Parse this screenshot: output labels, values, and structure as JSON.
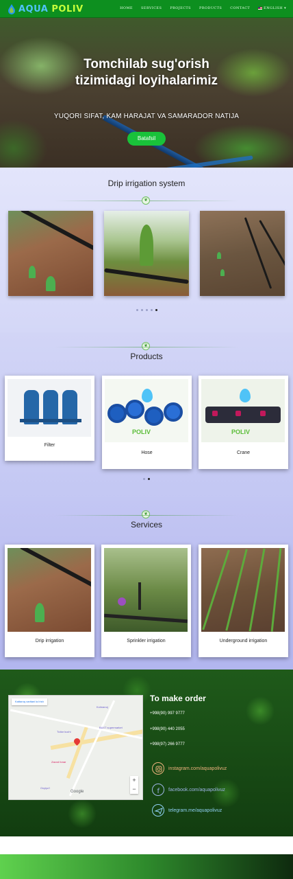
{
  "header": {
    "logo_part1": "AQUA",
    "logo_part2": "POLIV",
    "nav": [
      {
        "label": "HOME"
      },
      {
        "label": "SERVICES"
      },
      {
        "label": "PROJECTS"
      },
      {
        "label": "PRODUCTS"
      },
      {
        "label": "CONTACT"
      }
    ],
    "language": "ENGLISH",
    "language_caret": "▾"
  },
  "hero": {
    "title_line1": "Tomchilab sug'orish",
    "title_line2": "tizimidagi loyihalarimiz",
    "subtitle": "YUQORI SIFAT, KAM HARAJAT VA SAMARADOR NATIJA",
    "button": "Batafsil"
  },
  "drip": {
    "title": "Drip irrigation system",
    "slide_count": 5,
    "active_slide": 5
  },
  "products": {
    "title": "Products",
    "items": [
      {
        "label": "Filter"
      },
      {
        "label": "Hose"
      },
      {
        "label": "Crane"
      }
    ],
    "slide_count": 2,
    "active_slide": 2
  },
  "services": {
    "title": "Services",
    "items": [
      {
        "label": "Drip irrigation"
      },
      {
        "label": "Sprinkler irrigation"
      },
      {
        "label": "Underground irrigation"
      }
    ]
  },
  "order": {
    "title": "To make order",
    "phones": [
      "+998(90) 997 9777",
      "+998(90) 440 2055",
      "+998(97) 266 9777"
    ],
    "socials": [
      {
        "icon": "instagram-icon",
        "text": "instagram.com/aquapolivuz",
        "color": "#f0b37e"
      },
      {
        "icon": "facebook-icon",
        "text": "facebook.com/aquapolivuz",
        "color": "#9fb6e8"
      },
      {
        "icon": "telegram-icon",
        "text": "telegram.me/aquapolivuz",
        "color": "#8fd0f3"
      }
    ],
    "map": {
      "view_larger": "Kattaroq xaritani koʻrish",
      "zoom_in": "+",
      "zoom_out": "−",
      "google": "Google",
      "place1": "Kolmanoj",
      "place2": "BAXT supermarket",
      "place3": "Tutlar kuchi",
      "place4": "Oxyiyo'l",
      "place5": "Zavod fonar"
    }
  },
  "colors": {
    "header": "#0d8f1f",
    "accent_green": "#19c23a"
  }
}
